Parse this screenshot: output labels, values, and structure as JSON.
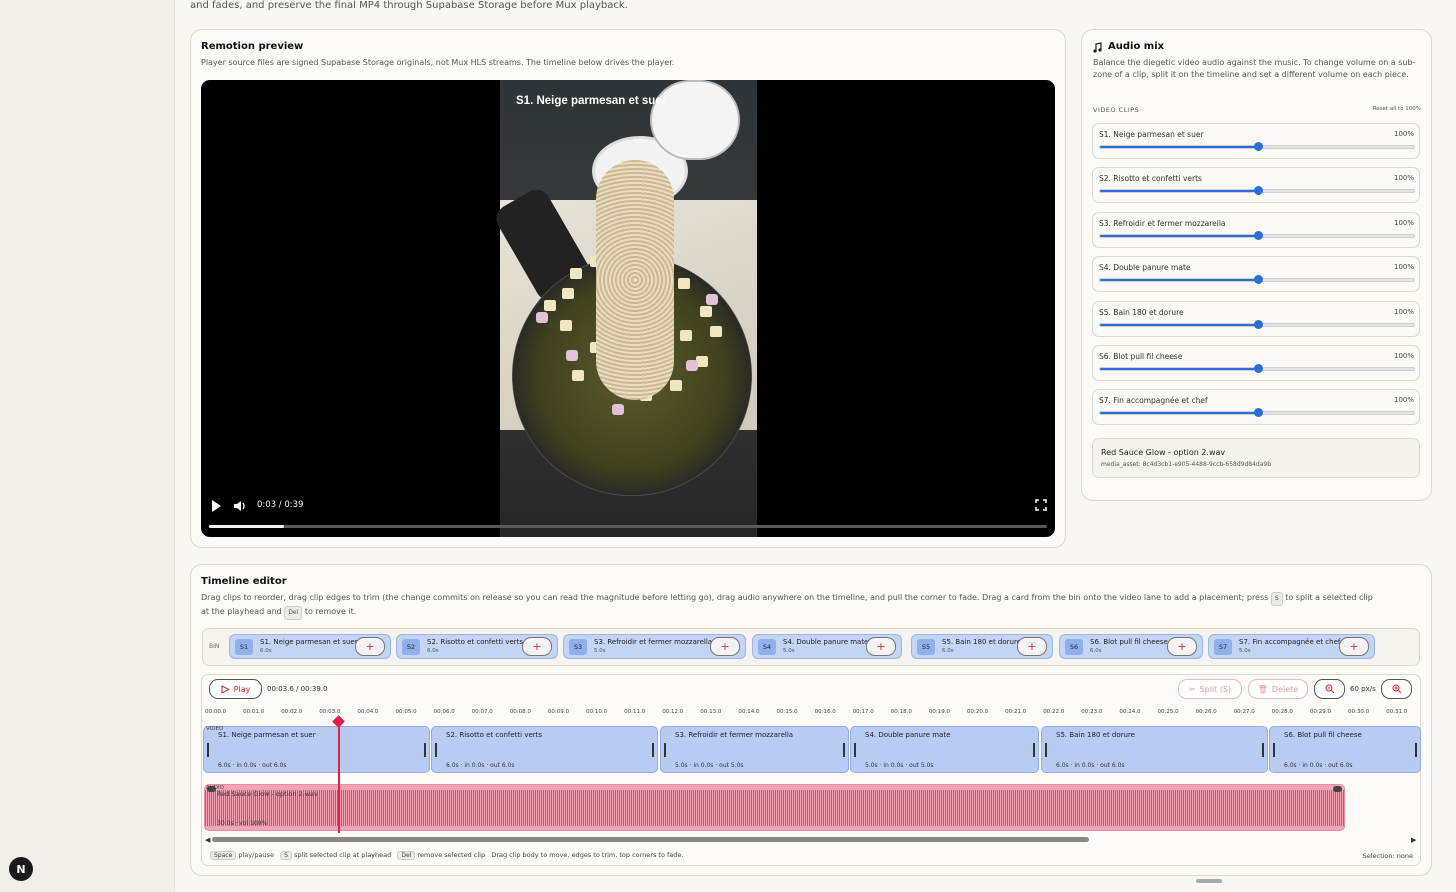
{
  "intro_text": "and fades, and preserve the final MP4 through Supabase Storage before Mux playback.",
  "preview": {
    "title": "Remotion preview",
    "subtitle": "Player source files are signed Supabase Storage originals, not Mux HLS streams. The timeline below drives the player.",
    "caption": "S1. Neige parmesan et suer",
    "time": "0:03 / 0:39",
    "progress": 0.09
  },
  "audio_mix": {
    "title": "Audio mix",
    "desc": "Balance the diegetic video audio against the music. To change volume on a sub-zone of a clip, split it on the timeline and set a different volume on each piece.",
    "section_label": "VIDEO CLIPS",
    "reset_label": "Reset all to 100%",
    "clips": [
      {
        "name": "S1. Neige parmesan et suer",
        "volume": "100%"
      },
      {
        "name": "S2. Risotto et confetti verts",
        "volume": "100%"
      },
      {
        "name": "S3. Refroidir et fermer mozzarella",
        "volume": "100%"
      },
      {
        "name": "S4. Double panure mate",
        "volume": "100%"
      },
      {
        "name": "S5. Bain 180 et dorure",
        "volume": "100%"
      },
      {
        "name": "S6. Blot pull fil cheese",
        "volume": "100%"
      },
      {
        "name": "S7. Fin accompagnée et chef",
        "volume": "100%"
      }
    ],
    "music_name": "Red Sauce Glow - option 2.wav",
    "music_asset": "media_asset: 8c4d3cb1-e905-4488-9ccb-658d9d84da9b"
  },
  "timeline": {
    "title": "Timeline editor",
    "desc_part1": "Drag clips to reorder, drag clip edges to trim (the change commits on release so you can read the magnitude before letting go), drag audio anywhere on the timeline, and pull the corner to fade. Drag a card from the bin onto the video lane to add a placement; press",
    "key_s": "S",
    "desc_part2": "to split a selected clip",
    "desc_part3": "at the playhead and",
    "key_del": "Del",
    "desc_part4": "to remove it.",
    "bin_label": "BIN",
    "bin": [
      {
        "id": "S1",
        "name": "S1. Neige parmesan et suer",
        "dur": "6.0s"
      },
      {
        "id": "S2",
        "name": "S2. Risotto et confetti verts",
        "dur": "6.0s"
      },
      {
        "id": "S3",
        "name": "S3. Refroidir et fermer mozzarella",
        "dur": "5.0s"
      },
      {
        "id": "S4",
        "name": "S4. Double panure mate",
        "dur": "5.0s"
      },
      {
        "id": "S5",
        "name": "S5. Bain 180 et dorure",
        "dur": "6.0s"
      },
      {
        "id": "S6",
        "name": "S6. Blot pull fil cheese",
        "dur": "6.0s"
      },
      {
        "id": "S7",
        "name": "S7. Fin accompagnée et chef",
        "dur": "5.0s"
      }
    ],
    "play_label": "Play",
    "time": "00:03.6 / 00:39.0",
    "split_label": "Split (S)",
    "delete_label": "Delete",
    "zoom": "60 px/s",
    "ticks": [
      "00:00.0",
      "00:01.0",
      "00:02.0",
      "00:03.0",
      "00:04.0",
      "00:05.0",
      "00:06.0",
      "00:07.0",
      "00:08.0",
      "00:09.0",
      "00:10.0",
      "00:11.0",
      "00:12.0",
      "00:13.0",
      "00:14.0",
      "00:15.0",
      "00:16.0",
      "00:17.0",
      "00:18.0",
      "00:19.0",
      "00:20.0",
      "00:21.0",
      "00:22.0",
      "00:23.0",
      "00:24.0",
      "00:25.0",
      "00:26.0",
      "00:27.0",
      "00:28.0",
      "00:29.0",
      "00:30.0",
      "00:31.0"
    ],
    "video_label": "VIDEO",
    "audio_label": "AUDIO",
    "video_clips": [
      {
        "name": "S1. Neige parmesan et suer",
        "detail": "6.0s · in 0.0s · out 6.0s"
      },
      {
        "name": "S2. Risotto et confetti verts",
        "detail": "6.0s · in 0.0s · out 6.0s"
      },
      {
        "name": "S3. Refroidir et fermer mozzarella",
        "detail": "5.0s · in 0.0s · out 5.0s"
      },
      {
        "name": "S4. Double panure mate",
        "detail": "5.0s · in 0.0s · out 5.0s"
      },
      {
        "name": "S5. Bain 180 et dorure",
        "detail": "6.0s · in 0.0s · out 6.0s"
      },
      {
        "name": "S6. Blot pull fil cheese",
        "detail": "6.0s · in 0.0s · out 6.0s"
      }
    ],
    "audio_clip": {
      "name": "Red Sauce Glow - option 2.wav",
      "detail": "30.0s · vol 100%"
    },
    "help": {
      "k1": "Space",
      "t1": "play/pause",
      "k2": "S",
      "t2": "split selected clip at playhead",
      "k3": "Del",
      "t3": "remove selected clip",
      "t4": "Drag clip body to move, edges to trim, top corners to fade."
    },
    "selection": "Selection: none"
  },
  "colors": {
    "accent": "#2b6fd6",
    "audio": "#e23e62",
    "playhead": "#e0204b"
  }
}
